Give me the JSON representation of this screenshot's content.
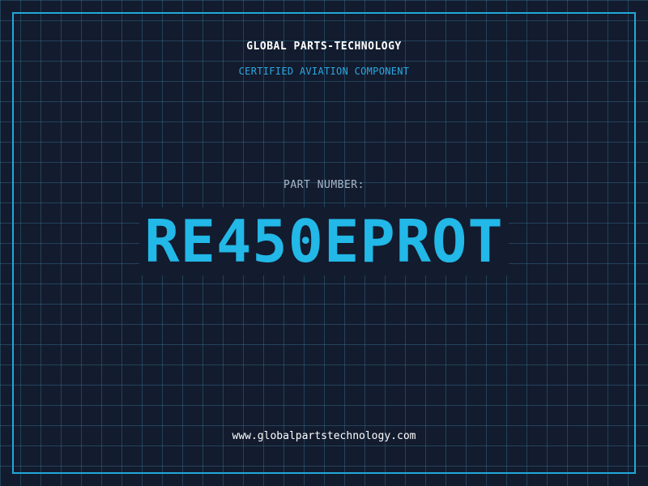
{
  "header": {
    "company": "GLOBAL PARTS-TECHNOLOGY",
    "tagline": "CERTIFIED AVIATION COMPONENT"
  },
  "main": {
    "label": "PART NUMBER:",
    "part_number": "RE450EPROT"
  },
  "footer": {
    "url": "www.globalpartstechnology.com"
  },
  "colors": {
    "background": "#131b2e",
    "grid": "#38829f",
    "accent": "#22b8e8",
    "text": "#ffffff",
    "muted": "#a8b8c8"
  }
}
